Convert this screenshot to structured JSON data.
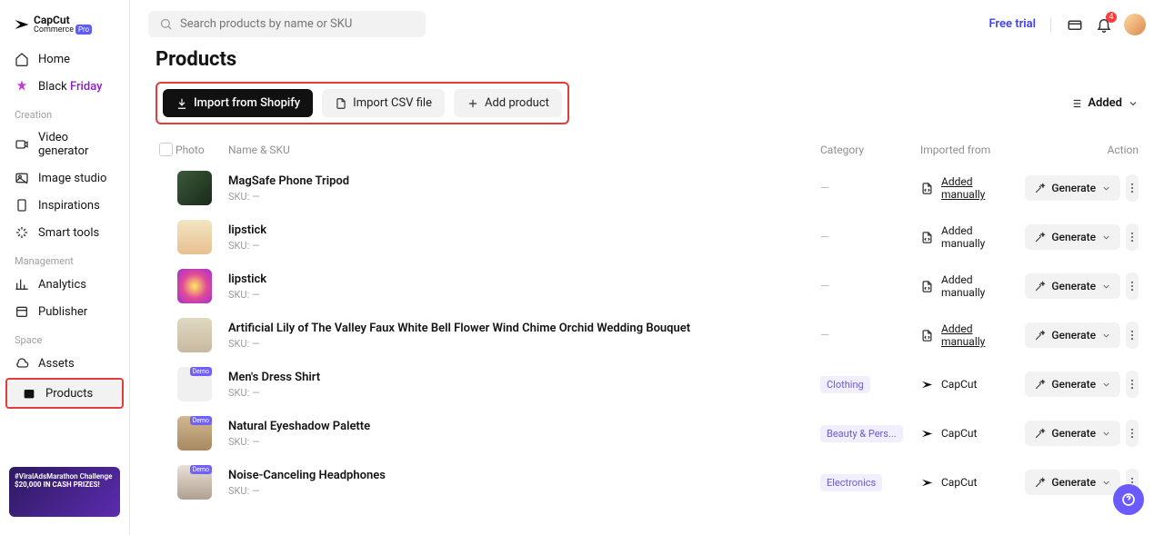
{
  "brand": {
    "name": "CapCut",
    "sub": "Commerce",
    "badge": "Pro"
  },
  "header": {
    "search_placeholder": "Search products by name or SKU",
    "free_trial": "Free trial",
    "notif_count": "4"
  },
  "sidebar": {
    "items_top": [
      {
        "label": "Home"
      },
      {
        "label_a": "Black",
        "label_b": " Friday"
      }
    ],
    "sections": [
      {
        "title": "Creation",
        "items": [
          {
            "label": "Video generator"
          },
          {
            "label": "Image studio"
          },
          {
            "label": "Inspirations"
          },
          {
            "label": "Smart tools"
          }
        ]
      },
      {
        "title": "Management",
        "items": [
          {
            "label": "Analytics"
          },
          {
            "label": "Publisher"
          }
        ]
      },
      {
        "title": "Space",
        "items": [
          {
            "label": "Assets"
          },
          {
            "label": "Products"
          }
        ]
      }
    ],
    "promo_line1": "#ViralAdsMarathon Challenge",
    "promo_line2": "$20,000 IN CASH PRIZES!"
  },
  "page": {
    "title": "Products",
    "btn_import_shopify": "Import from Shopify",
    "btn_import_csv": "Import CSV file",
    "btn_add": "Add product",
    "sort_label": "Added"
  },
  "columns": {
    "photo": "Photo",
    "name": "Name & SKU",
    "category": "Category",
    "imported": "Imported from",
    "action": "Action"
  },
  "labels": {
    "sku_prefix": "SKU: —",
    "generate": "Generate",
    "capcut": "CapCut",
    "added_manually": "Added manually",
    "demo": "Demo"
  },
  "products": [
    {
      "name": "MagSafe Phone Tripod",
      "category": "",
      "imported": "manual_u",
      "demo": false,
      "thumb": "t1"
    },
    {
      "name": "lipstick",
      "category": "",
      "imported": "manual",
      "demo": false,
      "thumb": "t2"
    },
    {
      "name": "lipstick",
      "category": "",
      "imported": "manual",
      "demo": false,
      "thumb": "t3"
    },
    {
      "name": "Artificial Lily of The Valley Faux White Bell Flower Wind Chime Orchid Wedding Bouquet",
      "category": "",
      "imported": "manual_u",
      "demo": false,
      "thumb": "t4"
    },
    {
      "name": "Men's Dress Shirt",
      "category": "Clothing",
      "imported": "capcut",
      "demo": true,
      "thumb": "t5"
    },
    {
      "name": "Natural Eyeshadow Palette",
      "category": "Beauty & Pers...",
      "imported": "capcut",
      "demo": true,
      "thumb": "t6"
    },
    {
      "name": "Noise-Canceling Headphones",
      "category": "Electronics",
      "imported": "capcut",
      "demo": true,
      "thumb": "t7"
    }
  ]
}
